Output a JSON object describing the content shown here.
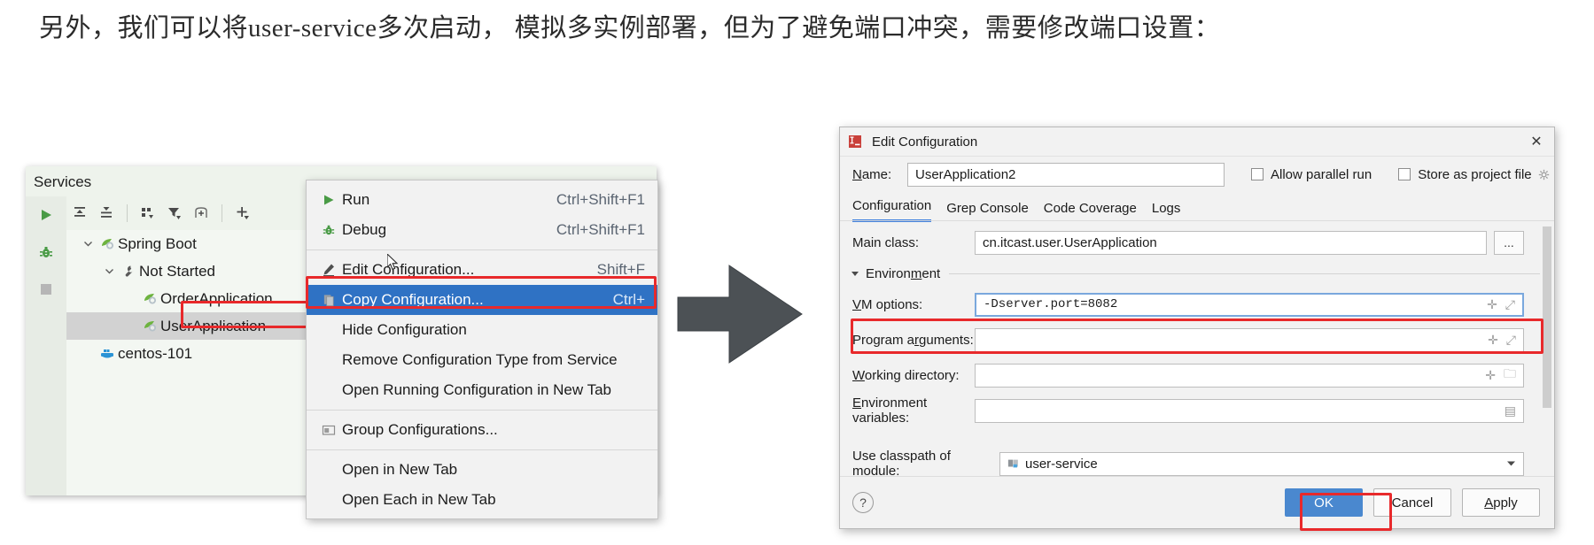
{
  "headline": "另外，我们可以将user-service多次启动， 模拟多实例部署，但为了避免端口冲突，需要修改端口设置：",
  "services_panel": {
    "title": "Services",
    "rail_buttons": [
      {
        "name": "run-icon",
        "label": "Run"
      },
      {
        "name": "debug-icon",
        "label": "Debug"
      },
      {
        "name": "stop-icon",
        "label": "Stop"
      }
    ],
    "toolbar_buttons": [
      {
        "name": "expand-all-icon",
        "label": "Expand All"
      },
      {
        "name": "collapse-all-icon",
        "label": "Collapse All"
      },
      {
        "name": "group-by-icon",
        "label": "Group By"
      },
      {
        "name": "filter-icon",
        "label": "Filter"
      },
      {
        "name": "add-tab-icon",
        "label": "Add Tab"
      },
      {
        "name": "add-icon",
        "label": "Add"
      }
    ],
    "tree": [
      {
        "label": "Spring Boot",
        "indent": 0,
        "icon": "spring-boot-icon",
        "chevron": "expanded",
        "selected": false
      },
      {
        "label": "Not Started",
        "indent": 1,
        "icon": "wrench-icon",
        "chevron": "expanded",
        "selected": false
      },
      {
        "label": "OrderApplication",
        "indent": 2,
        "icon": "spring-boot-icon",
        "chevron": "none",
        "selected": false
      },
      {
        "label": "UserApplication",
        "indent": 2,
        "icon": "spring-boot-icon",
        "chevron": "none",
        "selected": true
      },
      {
        "label": "centos-101",
        "indent": 0,
        "icon": "docker-icon",
        "chevron": "none",
        "selected": false
      }
    ]
  },
  "context_menu": {
    "items": [
      {
        "label": "Run",
        "shortcut": "Ctrl+Shift+F1",
        "icon": "run-icon",
        "highlight": false
      },
      {
        "label": "Debug",
        "shortcut": "Ctrl+Shift+F1",
        "icon": "debug-icon",
        "highlight": false
      },
      {
        "separator_after": true,
        "label": "",
        "shortcut": "",
        "icon": "",
        "highlight": false
      },
      {
        "label": "Edit Configuration...",
        "shortcut": "Shift+F",
        "icon": "pencil-icon",
        "highlight": false
      },
      {
        "label": "Copy Configuration...",
        "shortcut": "Ctrl+",
        "icon": "copy-icon",
        "highlight": true
      },
      {
        "label": "Hide Configuration",
        "shortcut": "",
        "icon": "",
        "highlight": false
      },
      {
        "label": "Remove Configuration Type from Service",
        "shortcut": "",
        "icon": "",
        "highlight": false
      },
      {
        "label": "Open Running Configuration in New Tab",
        "shortcut": "",
        "icon": "",
        "highlight": false
      },
      {
        "label": "Group Configurations...",
        "shortcut": "",
        "icon": "folder-icon",
        "highlight": false
      },
      {
        "label": "Open in New Tab",
        "shortcut": "",
        "icon": "",
        "highlight": false
      },
      {
        "label": "Open Each in New Tab",
        "shortcut": "",
        "icon": "",
        "highlight": false
      }
    ]
  },
  "dialog": {
    "title": "Edit Configuration",
    "close_label": "✕",
    "name_label": "Name:",
    "name_value": "UserApplication2",
    "allow_parallel_run": "Allow parallel run",
    "store_as_project_file": "Store as project file",
    "tabs": [
      {
        "label": "Configuration",
        "active": true
      },
      {
        "label": "Grep Console",
        "active": false
      },
      {
        "label": "Code Coverage",
        "active": false
      },
      {
        "label": "Logs",
        "active": false
      }
    ],
    "fields": {
      "main_class_label": "Main class:",
      "main_class_value": "cn.itcast.user.UserApplication",
      "main_class_browse": "...",
      "environment_label": "Environment",
      "vm_options_label": "VM options:",
      "vm_options_value": "-Dserver.port=8082",
      "program_arguments_label": "Program arguments:",
      "program_arguments_value": "",
      "working_directory_label": "Working directory:",
      "working_directory_value": "",
      "environment_variables_label": "Environment variables:",
      "environment_variables_value": "",
      "use_classpath_label": "Use classpath of module:",
      "use_classpath_value": "user-service"
    },
    "footer": {
      "help": "?",
      "ok": "OK",
      "cancel": "Cancel",
      "apply": "Apply"
    }
  },
  "colors": {
    "highlight_red": "#e8292b",
    "menu_selection_blue": "#2f72c4",
    "primary_button_blue": "#4a88cf",
    "tab_accent": "#3b7ddd",
    "spring_green": "#6db33f"
  }
}
